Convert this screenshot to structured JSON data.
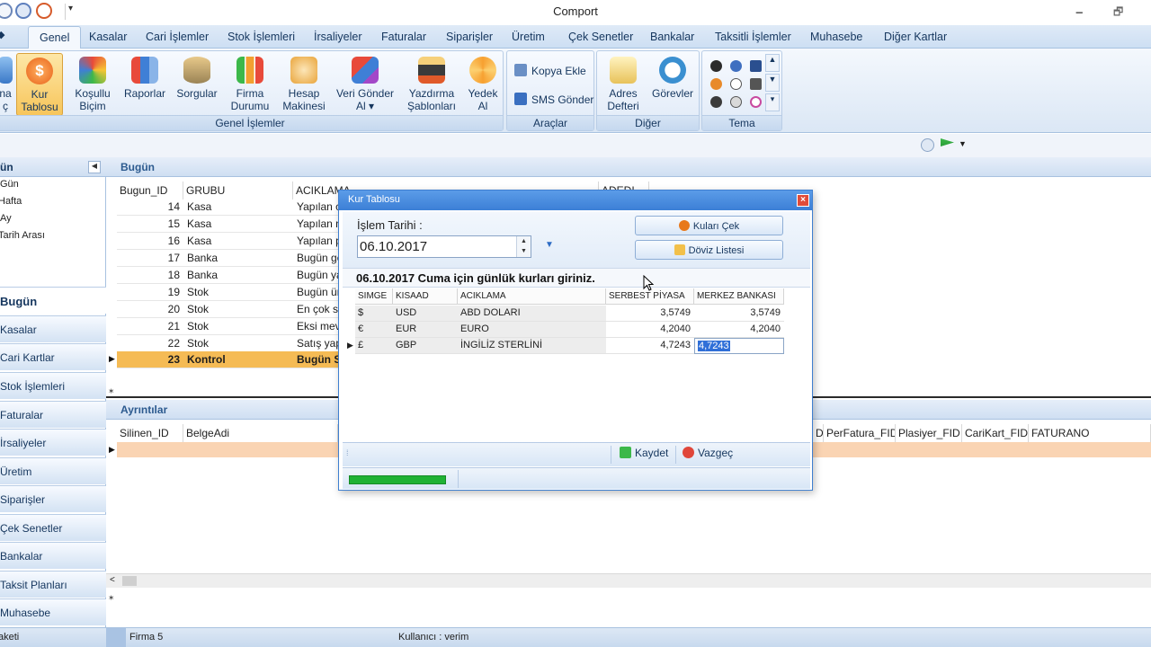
{
  "window": {
    "title": "Comport",
    "minimize": "🗕",
    "restore": "🗗"
  },
  "ribbon_tabs": [
    "Genel",
    "Kasalar",
    "Cari İşlemler",
    "Stok İşlemleri",
    "İrsaliyeler",
    "Faturalar",
    "Siparişler",
    "Üretim",
    "Çek Senetler",
    "Bankalar",
    "Taksitli İşlemler",
    "Muhasebe",
    "Diğer Kartlar"
  ],
  "ribbon": {
    "genel_islemler": {
      "label": "Genel İşlemler",
      "buttons": [
        {
          "label": "na\nç",
          "icon": "cut-icon"
        },
        {
          "label": "Kur\nTablosu",
          "icon": "dollar-coin-icon"
        },
        {
          "label": "Koşullu\nBiçim",
          "icon": "format-icon"
        },
        {
          "label": "Raporlar",
          "icon": "report-icon"
        },
        {
          "label": "Sorgular",
          "icon": "database-icon"
        },
        {
          "label": "Firma\nDurumu",
          "icon": "bar-chart-icon"
        },
        {
          "label": "Hesap\nMakinesi",
          "icon": "calculator-icon"
        },
        {
          "label": "Veri Gönder\nAl ▾",
          "icon": "cubes-icon"
        },
        {
          "label": "Yazdırma\nŞablonları",
          "icon": "printer-icon"
        },
        {
          "label": "Yedek\nAl",
          "icon": "backup-icon"
        }
      ]
    },
    "araclar": {
      "label": "Araçlar",
      "kopya_ekle": "Kopya Ekle",
      "sms_gonder": "SMS Gönder"
    },
    "diger": {
      "label": "Diğer",
      "adres_defteri": "Adres\nDefteri",
      "gorevler": "Görevler"
    },
    "tema": {
      "label": "Tema"
    }
  },
  "leftnav": {
    "header": "ün",
    "sub_items": [
      "Gün",
      "Hafta",
      "Ay",
      "Tarih Arası"
    ],
    "nav_buttons": [
      "Bugün",
      "Kasalar",
      "Cari Kartlar",
      "Stok İşlemleri",
      "Faturalar",
      "İrsaliyeler",
      "Üretim",
      "Siparişler",
      "Çek Senetler",
      "Bankalar",
      "Taksit Planları",
      "Muhasebe"
    ]
  },
  "bugun_panel": {
    "title": "Bugün",
    "columns": [
      "Bugun_ID",
      "GRUBU",
      "ACIKLAMA",
      "ADEDI"
    ],
    "rows": [
      {
        "id": "14",
        "grup": "Kasa",
        "aciklama": "Yapılan c"
      },
      {
        "id": "15",
        "grup": "Kasa",
        "aciklama": "Yapılan n"
      },
      {
        "id": "16",
        "grup": "Kasa",
        "aciklama": "Yapılan p"
      },
      {
        "id": "17",
        "grup": "Banka",
        "aciklama": "Bugün ge"
      },
      {
        "id": "18",
        "grup": "Banka",
        "aciklama": "Bugün ya"
      },
      {
        "id": "19",
        "grup": "Stok",
        "aciklama": "Bugün ür"
      },
      {
        "id": "20",
        "grup": "Stok",
        "aciklama": "En çok s"
      },
      {
        "id": "21",
        "grup": "Stok",
        "aciklama": "Eksi mev"
      },
      {
        "id": "22",
        "grup": "Stok",
        "aciklama": "Satış yap"
      },
      {
        "id": "23",
        "grup": "Kontrol",
        "aciklama": "Bugün S"
      }
    ]
  },
  "ayrintilar_panel": {
    "title": "Ayrıntılar",
    "columns_left": [
      "Silinen_ID",
      "BelgeAdi"
    ],
    "columns_right": [
      "D",
      "PerFatura_FID",
      "Plasiyer_FID",
      "CariKart_FID",
      "FATURANO"
    ]
  },
  "statusbar": {
    "left": "aketi",
    "firma": "Firma 5",
    "kullanici": "Kullanıcı : verim"
  },
  "dialog": {
    "title": "Kur Tablosu",
    "date_label": "İşlem Tarihi :",
    "date_value": "06.10.2017",
    "btn_kurlari_cek": "Kuları Çek",
    "btn_doviz_listesi": "Döviz Listesi",
    "info_text": "06.10.2017 Cuma için günlük kurları giriniz.",
    "grid_columns": [
      "SIMGE",
      "KISAAD",
      "ACIKLAMA",
      "SERBEST PİYASA",
      "MERKEZ BANKASI"
    ],
    "grid_rows": [
      {
        "simge": "$",
        "kisaad": "USD",
        "aciklama": "ABD DOLARI",
        "serbest": "3,5749",
        "merkez": "3,5749"
      },
      {
        "simge": "€",
        "kisaad": "EUR",
        "aciklama": "EURO",
        "serbest": "4,2040",
        "merkez": "4,2040"
      },
      {
        "simge": "£",
        "kisaad": "GBP",
        "aciklama": "İNGİLİZ STERLİNİ",
        "serbest": "4,7243",
        "merkez": "4,7243"
      }
    ],
    "btn_kaydet": "Kaydet",
    "btn_vazgec": "Vazgeç",
    "progress": 0.2
  },
  "colors": {
    "accent": "#3c7fd6",
    "selected_row": "#f5bb55",
    "progress": "#1fb234"
  }
}
